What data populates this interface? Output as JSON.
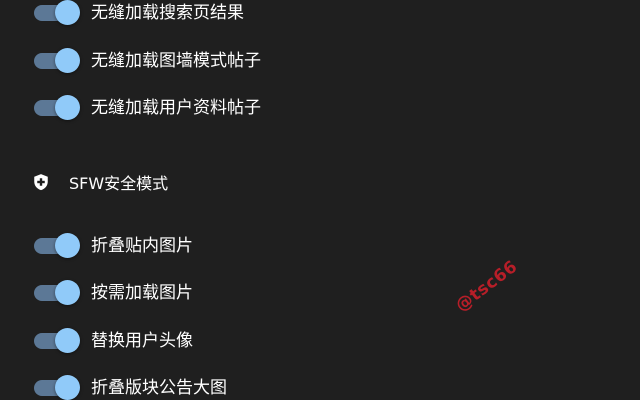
{
  "settings": {
    "toggles_top": [
      {
        "label": "无缝加载搜索页结果",
        "enabled": true
      },
      {
        "label": "无缝加载图墙模式帖子",
        "enabled": true
      },
      {
        "label": "无缝加载用户资料帖子",
        "enabled": true
      }
    ],
    "sfw_section": {
      "icon": "shield-plus-icon",
      "title": "SFW安全模式",
      "toggles": [
        {
          "label": "折叠贴内图片",
          "enabled": true
        },
        {
          "label": "按需加载图片",
          "enabled": true
        },
        {
          "label": "替换用户头像",
          "enabled": true
        },
        {
          "label": "折叠版块公告大图",
          "enabled": true
        }
      ]
    }
  },
  "colors": {
    "background": "#1f1f1f",
    "switch_track": "#5c7896",
    "switch_thumb": "#90caf9",
    "text": "#ffffff",
    "watermark": "#c81e2a"
  },
  "watermark": "@tsc66"
}
